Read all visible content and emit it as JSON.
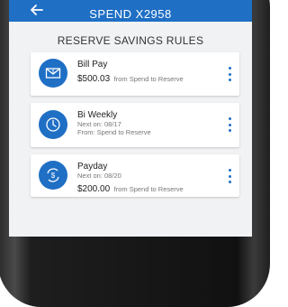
{
  "header": {
    "title": "SPEND X2958"
  },
  "page": {
    "section_title": "RESERVE SAVINGS RULES"
  },
  "rules": [
    {
      "name": "Bill Pay",
      "amount": "$500.03",
      "amount_suffix": "from Spend to Reserve",
      "icon": "bill-envelope-icon"
    },
    {
      "name": "Bi Weekly",
      "line1": "Next on: 08/17",
      "line2": "From: Spend to Reserve",
      "icon": "clock-icon"
    },
    {
      "name": "Payday",
      "line1": "Next on: 08/20",
      "amount": "$200.00",
      "amount_suffix": "from Spend to Reserve",
      "icon": "dollar-cycle-icon"
    }
  ],
  "colors": {
    "accent": "#1f6fc5",
    "background": "#f1f2f4"
  }
}
